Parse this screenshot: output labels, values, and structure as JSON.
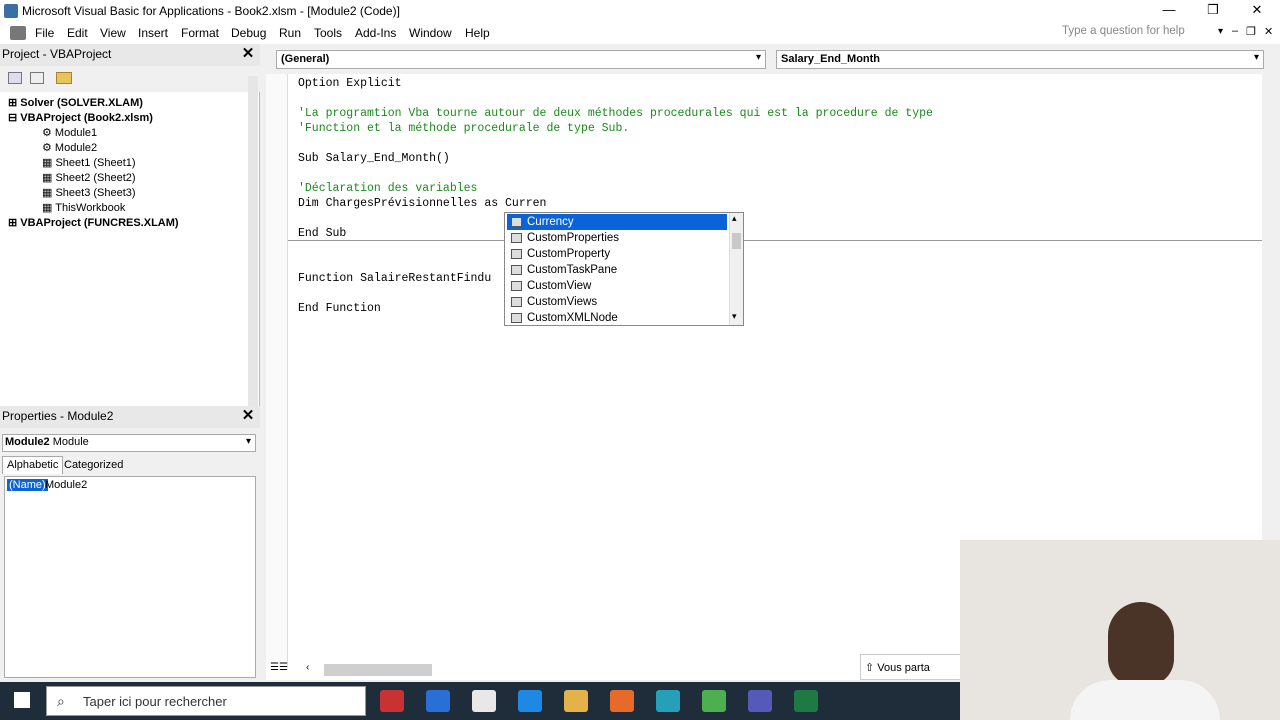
{
  "window": {
    "title": "Microsoft Visual Basic for Applications - Book2.xlsm - [Module2 (Code)]"
  },
  "menu": [
    "File",
    "Edit",
    "View",
    "Insert",
    "Format",
    "Debug",
    "Run",
    "Tools",
    "Add-Ins",
    "Window",
    "Help"
  ],
  "help_placeholder": "Type a question for help",
  "project_pane": {
    "title": "Project - VBAProject",
    "tree": [
      {
        "label": "Solver (SOLVER.XLAM)",
        "bold": true
      },
      {
        "label": "VBAProject (Book2.xlsm)",
        "bold": true
      },
      {
        "label": "Module1",
        "bold": false
      },
      {
        "label": "Module2",
        "bold": false
      },
      {
        "label": "Sheet1 (Sheet1)",
        "bold": false
      },
      {
        "label": "Sheet2 (Sheet2)",
        "bold": false
      },
      {
        "label": "Sheet3 (Sheet3)",
        "bold": false
      },
      {
        "label": "ThisWorkbook",
        "bold": false
      },
      {
        "label": "VBAProject (FUNCRES.XLAM)",
        "bold": true
      }
    ]
  },
  "code": {
    "object_combo": "(General)",
    "proc_combo": "Salary_End_Month",
    "lines": [
      {
        "text": "Option Explicit",
        "comment": false
      },
      {
        "text": "'La programtion Vba tourne autour de deux méthodes procedurales qui est la procedure de type",
        "comment": true
      },
      {
        "text": "'Function et la méthode procedurale de type Sub.",
        "comment": true
      },
      {
        "text": "Sub Salary_End_Month()",
        "comment": false
      },
      {
        "text": "'Déclaration des variables",
        "comment": true
      },
      {
        "text": "Dim ChargesPrévisionnelles as Curren",
        "comment": false
      },
      {
        "text": "End Sub",
        "comment": false
      },
      {
        "text": "Function SalaireRestantFindu",
        "comment": false
      },
      {
        "text": "End Function",
        "comment": false
      }
    ]
  },
  "autocomplete": {
    "items": [
      "Currency",
      "CustomProperties",
      "CustomProperty",
      "CustomTaskPane",
      "CustomView",
      "CustomViews",
      "CustomXMLNode"
    ],
    "selected_index": 0
  },
  "properties_pane": {
    "title": "Properties - Module2",
    "object": "Module2",
    "object_type": "Module",
    "tabs": [
      "Alphabetic",
      "Categorized"
    ],
    "property_name": "(Name)",
    "property_value": "Module2"
  },
  "bottom_notice": "Vous parta",
  "taskbar": {
    "search_placeholder": "Taper ici pour rechercher"
  }
}
